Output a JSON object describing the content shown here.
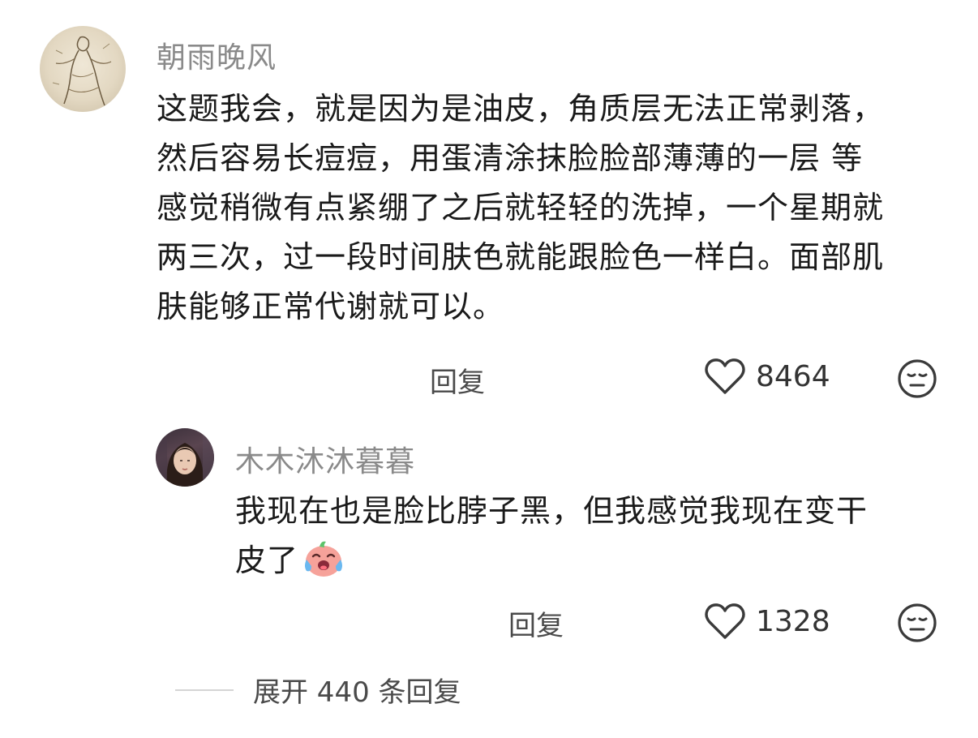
{
  "comments": [
    {
      "username": "朝雨晚风",
      "lines": [
        "这题我会，就是因为是油皮，角质层无法正常剥落，",
        "然后容易长痘痘，用蛋清涂抹脸脸部薄薄的一层 等",
        "感觉稍微有点紧绷了之后就轻轻的洗掉，一个星期就",
        "两三次，过一段时间肤色就能跟脸色一样白。面部肌",
        "肤能够正常代谢就可以。"
      ],
      "reply_label": "回复",
      "like_count": "8464"
    },
    {
      "username": "木木沐沐暮暮",
      "lines": [
        "我现在也是脸比脖子黑，但我感觉我现在变干",
        "皮了"
      ],
      "reply_label": "回复",
      "like_count": "1328"
    }
  ],
  "expand_replies_label": "展开 440 条回复",
  "icons": {
    "like": "heart-outline-icon",
    "reaction": "neutral-face-icon",
    "inline_emoji": "crying-laughing-emoji"
  }
}
